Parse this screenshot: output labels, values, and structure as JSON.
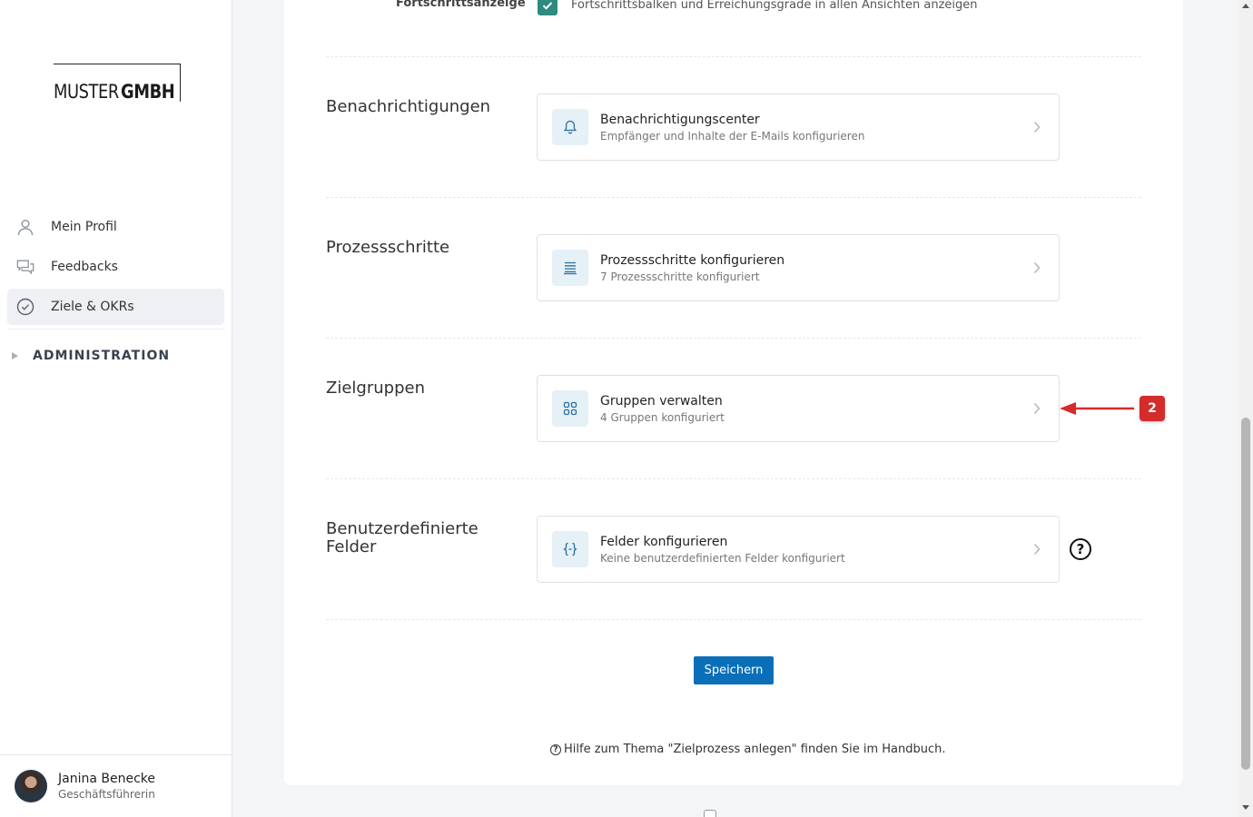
{
  "brand": {
    "logo_thin": "MUSTER",
    "logo_bold": "GMBH"
  },
  "sidebar": {
    "items": [
      {
        "label": "Mein Profil",
        "icon": "user-icon"
      },
      {
        "label": "Feedbacks",
        "icon": "chat-bubbles-icon"
      },
      {
        "label": "Ziele & OKRs",
        "icon": "check-circle-icon",
        "active": true
      }
    ],
    "admin_label": "ADMINISTRATION"
  },
  "user": {
    "name": "Janina Benecke",
    "role": "Geschäftsführerin"
  },
  "progress_setting": {
    "label": "Fortschrittsanzeige",
    "description": "Fortschrittsbalken und Erreichungsgrade in allen Ansichten anzeigen",
    "checked": true
  },
  "sections": [
    {
      "title": "Benachrichtigungen",
      "card_title": "Benachrichtigungscenter",
      "card_subtitle": "Empfänger und Inhalte der E-Mails konfigurieren",
      "icon": "bell-icon"
    },
    {
      "title": "Prozessschritte",
      "card_title": "Prozessschritte konfigurieren",
      "card_subtitle": "7 Prozessschritte konfiguriert",
      "icon": "list-icon"
    },
    {
      "title": "Zielgruppen",
      "card_title": "Gruppen verwalten",
      "card_subtitle": "4 Gruppen konfiguriert",
      "icon": "grid-icon"
    },
    {
      "title": "Benutzerdefinierte Felder",
      "card_title": "Felder konfigurieren",
      "card_subtitle": "Keine benutzerdefinierten Felder konfiguriert",
      "icon": "braces-icon"
    }
  ],
  "help_icon_glyph": "?",
  "save_label": "Speichern",
  "help_text": "Hilfe zum Thema \"Zielprozess anlegen\" finden Sie im Handbuch.",
  "annotation": {
    "step": "2",
    "color": "#d42b2b"
  },
  "colors": {
    "accent": "#0a6fb8",
    "checkbox": "#2e8b7e",
    "icon_tile": "#e6f0f7"
  }
}
